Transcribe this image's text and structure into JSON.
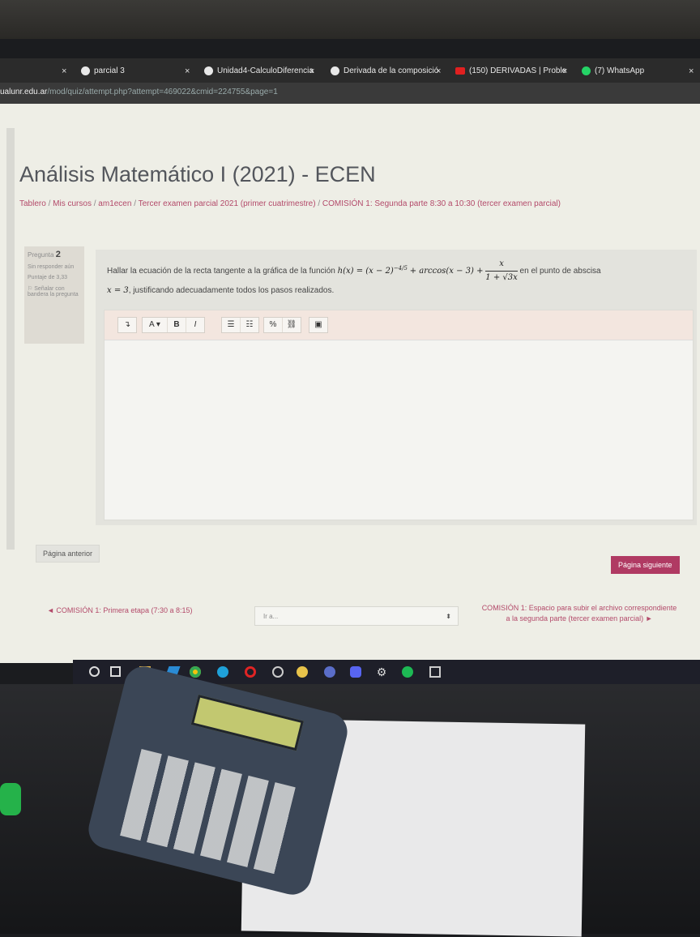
{
  "browser": {
    "tabs": [
      {
        "label": "parcial 3",
        "icon": "globe-icon"
      },
      {
        "label": "Unidad4-CalculoDiferencia",
        "icon": "globe-icon"
      },
      {
        "label": "Derivada de la composició",
        "icon": "globe-icon"
      },
      {
        "label": "(150) DERIVADAS | Proble",
        "icon": "youtube-icon"
      },
      {
        "label": "(7) WhatsApp",
        "icon": "whatsapp-icon"
      }
    ],
    "close_glyph": "×",
    "url_domain": "ualunr.edu.ar",
    "url_path": "/mod/quiz/attempt.php?attempt=469022&cmid=224755&page=1"
  },
  "course": {
    "title": "Análisis Matemático I (2021) - ECEN",
    "breadcrumb": [
      "Tablero",
      "Mis cursos",
      "am1ecen",
      "Tercer examen parcial 2021 (primer cuatrimestre)",
      "COMISIÓN 1: Segunda parte 8:30 a 10:30 (tercer examen parcial)"
    ],
    "breadcrumb_sep": "/"
  },
  "question_info": {
    "label": "Pregunta",
    "number": "2",
    "status": "Sin responder aún",
    "score": "Puntaje de 3,33",
    "flag": "Señalar con bandera la pregunta"
  },
  "question": {
    "text_before": "Hallar la ecuación de la recta tangente a la gráfica de la función",
    "formula_main": "h(x) = (x − 2)",
    "exponent": "−4/5",
    "formula_arc": "+ arccos(x − 3) +",
    "frac_num": "x",
    "frac_den": "1 + √3x",
    "text_after": "en el punto de abscisa",
    "point": "x = 3",
    "text_end": ", justificando adecuadamente todos los pasos realizados."
  },
  "editor": {
    "buttons": [
      "↴",
      "A ▾",
      "B",
      "I",
      "☰",
      "☷",
      "%",
      "⛓",
      "▣"
    ]
  },
  "nav": {
    "prev_button": "Página anterior",
    "next_button": "Página siguiente",
    "prev_link": "◄ COMISIÓN 1: Primera etapa (7:30 a 8:15)",
    "jump_placeholder": "Ir a...",
    "jump_arrow": "⬍",
    "next_link": "COMISIÓN 1: Espacio para subir el archivo correspondiente a la segunda parte (tercer examen parcial) ►"
  },
  "taskbar": {
    "icons": [
      "cortana-icon",
      "task-view-icon",
      "file-explorer-icon",
      "vscode-icon",
      "chrome-icon",
      "edge-icon",
      "opera-icon",
      "app-icon",
      "app-icon",
      "word-icon",
      "discord-icon",
      "settings-icon",
      "spotify-icon",
      "app-icon"
    ]
  }
}
